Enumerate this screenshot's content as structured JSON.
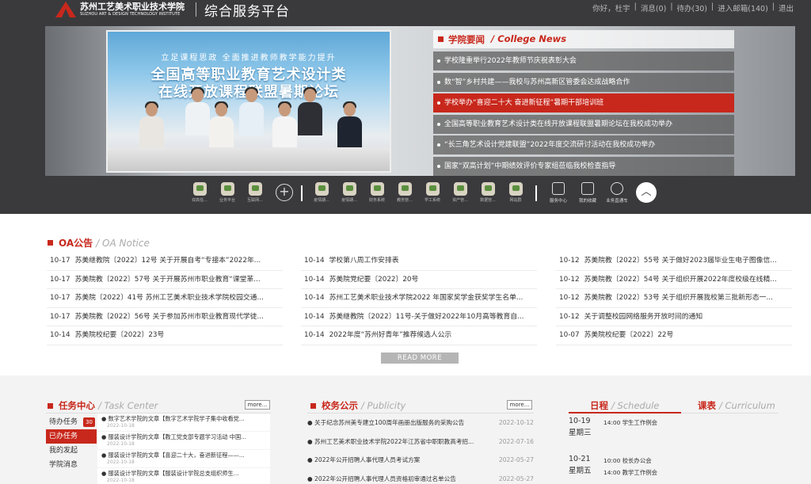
{
  "header": {
    "college_cn": "苏州工艺美术职业技术学院",
    "college_en": "SUZHOU ART & DESIGN TECHNOLOGY INSTITUTE",
    "platform": "综合服务平台",
    "greeting": "你好，杜宇",
    "messages": "消息(0)",
    "todo": "待办(30)",
    "mailbox": "进入邮箱(140)",
    "logout": "退出"
  },
  "banner": {
    "photo_line1": "立足课程思政  全面推进教师教学能力提升",
    "photo_line2": "全国高等职业教育艺术设计类",
    "photo_line3": "在线开放课程联盟暑期论坛"
  },
  "news": {
    "title_cn": "学院要闻",
    "title_en": "/ College News",
    "items": [
      "学校隆重举行2022年教师节庆祝表彰大会",
      "数“智”乡村共建——我校与苏州高新区管委会达成战略合作",
      "学校举办“喜迎二十大 奋进新征程”暑期干部培训班",
      "全国高等职业教育艺术设计类在线开放课程联盟暑期论坛在我校成功举办",
      "“长三角艺术设计党建联盟”2022年度交流研讨活动在我校成功举办",
      "国家“双高计划”中期绩效评价专家组莅临我校检查指导"
    ],
    "active_index": 2
  },
  "apps": [
    {
      "label": "双高任...",
      "icon": "app-icon"
    },
    {
      "label": "业务平台",
      "icon": "app-icon"
    },
    {
      "label": "互联网...",
      "icon": "app-icon"
    },
    {
      "label": "疫情期...",
      "icon": "app-icon"
    },
    {
      "label": "疫情期...",
      "icon": "app-icon"
    },
    {
      "label": "财务系统",
      "icon": "app-icon"
    },
    {
      "label": "教务管...",
      "icon": "app-icon"
    },
    {
      "label": "学工系统",
      "icon": "app-icon"
    },
    {
      "label": "资产管...",
      "icon": "app-icon"
    },
    {
      "label": "数据管...",
      "icon": "app-icon"
    },
    {
      "label": "网站群",
      "icon": "app-icon"
    }
  ],
  "services": [
    {
      "label": "服务中心",
      "icon": "grid-icon"
    },
    {
      "label": "我的收藏",
      "icon": "folder-star-icon"
    },
    {
      "label": "业务直通车",
      "icon": "link-icon"
    }
  ],
  "oa": {
    "title_cn": "OA公告",
    "title_en": "/ OA Notice",
    "columns": [
      [
        {
          "date": "10-17",
          "title": "苏美继教院〔2022〕12号 关于开展自考“专接本”2022年..."
        },
        {
          "date": "10-17",
          "title": "苏美院教〔2022〕57号 关于开展苏州市职业教育“课堂革..."
        },
        {
          "date": "10-17",
          "title": "苏美院〔2022〕41号 苏州工艺美术职业技术学院校园交通..."
        },
        {
          "date": "10-17",
          "title": "苏美院教〔2022〕56号 关于参加苏州市职业教育现代学徒..."
        },
        {
          "date": "10-14",
          "title": "苏美院校纪要〔2022〕23号"
        }
      ],
      [
        {
          "date": "10-14",
          "title": "学校第八周工作安排表"
        },
        {
          "date": "10-14",
          "title": "苏美院党纪要〔2022〕20号"
        },
        {
          "date": "10-14",
          "title": "苏州工艺美术职业技术学院2022 年国家奖学金获奖学生名单..."
        },
        {
          "date": "10-14",
          "title": "苏美继教院〔2022〕11号-关于做好2022年10月高等教育自..."
        },
        {
          "date": "10-14",
          "title": "2022年度“苏州好青年”推荐候选人公示"
        }
      ],
      [
        {
          "date": "10-12",
          "title": "苏美院教〔2022〕55号 关于做好2023届毕业生电子图像信..."
        },
        {
          "date": "10-12",
          "title": "苏美院教〔2022〕54号 关于组织开展2022年度校级在线精..."
        },
        {
          "date": "10-12",
          "title": "苏美院教〔2022〕53号 关于组织开展我校第三批新形态一..."
        },
        {
          "date": "10-12",
          "title": "关于调整校园网络服务开放时间的通知"
        },
        {
          "date": "10-07",
          "title": "苏美院校纪要〔2022〕22号"
        }
      ]
    ],
    "read_more": "READ MORE"
  },
  "task": {
    "title_cn": "任务中心",
    "title_en": "/ Task Center",
    "more": "more...",
    "menu": [
      {
        "label": "待办任务",
        "badge": "30"
      },
      {
        "label": "已办任务",
        "badge": ""
      },
      {
        "label": "我的发起",
        "badge": ""
      },
      {
        "label": "学院消息",
        "badge": ""
      }
    ],
    "items": [
      {
        "title": "● 数字艺术学院的文章【数字艺术学院学子集中收看党...",
        "date": "2022-10-18"
      },
      {
        "title": "● 服装设计学院的文章【教工党支部专题学习活动 中国...",
        "date": "2022-10-18"
      },
      {
        "title": "● 服装设计学院的文章【喜迎二十大，奋进新征程——...",
        "date": "2022-10-18"
      },
      {
        "title": "● 服装设计学院的文章【服装设计学院总支组织师生...",
        "date": "2022-10-18"
      }
    ]
  },
  "publicity": {
    "title_cn": "校务公示",
    "title_en": "/ Publicity",
    "more": "more...",
    "items": [
      {
        "title": "● 关于纪念苏州美专建立100周年画册出版服务的采购公告",
        "date": "2022-10-12"
      },
      {
        "title": "● 苏州工艺美术职业技术学院2022年江苏省中职职教高考招...",
        "date": "2022-07-16"
      },
      {
        "title": "● 2022年公开招聘人事代理人员考试方案",
        "date": "2022-05-27"
      },
      {
        "title": "● 2022年公开招聘人事代理人员资格初审通过名单公告",
        "date": "2022-05-27"
      }
    ]
  },
  "schedule": {
    "tab_schedule_cn": "日程",
    "tab_schedule_en": "/ Schedule",
    "tab_curriculum_cn": "课表",
    "tab_curriculum_en": "/ Curriculum",
    "days": [
      {
        "date": "10-19",
        "weekday": "星期三",
        "events": [
          "14:00 学生工作例会"
        ]
      },
      {
        "date": "10-21",
        "weekday": "星期五",
        "events": [
          "10:00 校长办公会",
          "14:00 教学工作例会"
        ]
      }
    ]
  }
}
